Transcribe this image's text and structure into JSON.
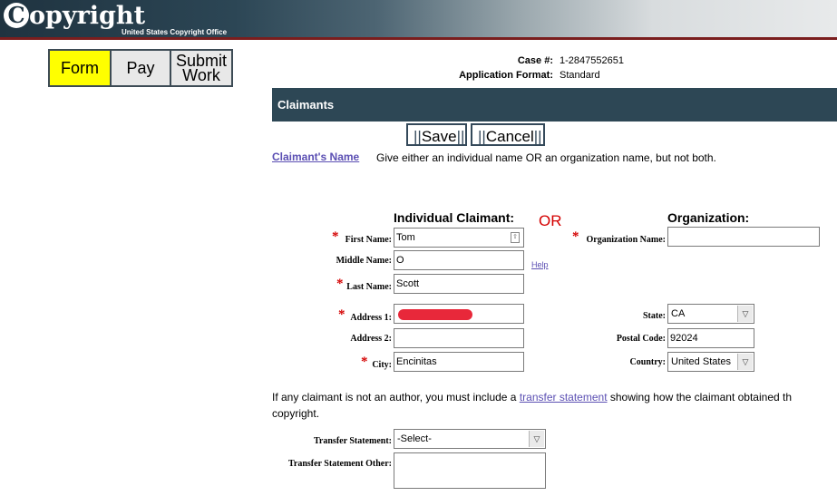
{
  "header": {
    "logo_c": "C",
    "logo_text": "opyright",
    "logo_subtitle": "United States Copyright Office"
  },
  "steps": [
    {
      "label": "Form",
      "active": true
    },
    {
      "label": "Pay",
      "active": false
    },
    {
      "label_line1": "Submit",
      "label_line2": "Work",
      "active": false
    }
  ],
  "case": {
    "case_label": "Case #:",
    "case_value": "1-2847552651",
    "format_label": "Application Format:",
    "format_value": "Standard"
  },
  "section": {
    "title": "Claimants"
  },
  "buttons": {
    "save": "Save",
    "cancel": "Cancel"
  },
  "claimant_name": {
    "link": "Claimant's Name",
    "instruction": "Give either an individual name OR an organization name, but not both."
  },
  "individual": {
    "heading": "Individual Claimant:",
    "first_name": {
      "label": "First Name:",
      "value": "Tom"
    },
    "middle_name": {
      "label": "Middle Name:",
      "value": "O"
    },
    "last_name": {
      "label": "Last Name:",
      "value": "Scott"
    },
    "address1": {
      "label": "Address 1:",
      "value": ""
    },
    "address2": {
      "label": "Address 2:",
      "value": ""
    },
    "city": {
      "label": "City:",
      "value": "Encinitas"
    }
  },
  "or_text": "OR",
  "help": "Help",
  "organization": {
    "heading": "Organization:",
    "name": {
      "label": "Organization Name:",
      "value": ""
    },
    "state": {
      "label": "State:",
      "value": "CA"
    },
    "postal": {
      "label": "Postal Code:",
      "value": "92024"
    },
    "country": {
      "label": "Country:",
      "value": "United States"
    }
  },
  "required_marker": "*",
  "transfer": {
    "text_before": "If any claimant is not an author, you must include a ",
    "link": "transfer statement",
    "text_after": " showing how the claimant obtained th",
    "text_line2": "copyright.",
    "statement": {
      "label": "Transfer Statement:",
      "value": "-Select-"
    },
    "other": {
      "label": "Transfer Statement Other:",
      "value": ""
    }
  },
  "colors": {
    "accent_bar": "#2d4755",
    "required": "#d40000",
    "active_step": "#ffff00",
    "link": "#5b4fb3"
  }
}
